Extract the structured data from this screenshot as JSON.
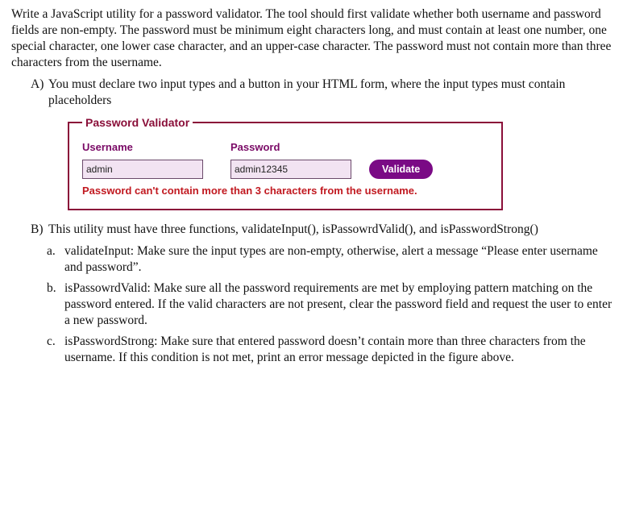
{
  "intro": "Write a JavaScript utility for a password validator. The tool should first validate whether both username and password fields are non-empty. The password must be minimum eight characters long, and must contain at least one number, one special character, one lower case character, and an upper-case character. The password must not contain more than three characters from the username.",
  "itemA": {
    "marker": "A)",
    "text": "You must declare two input types and a button in your HTML form, where the input types must contain placeholders"
  },
  "form": {
    "legend": "Password Validator",
    "username_label": "Username",
    "password_label": "Password",
    "username_value": "admin",
    "password_value": "admin12345",
    "username_placeholder": "",
    "password_placeholder": "",
    "validate_label": "Validate",
    "error_message": "Password can't contain more than 3 characters from the username."
  },
  "itemB": {
    "marker": "B)",
    "text": "This utility must have three functions, validateInput(), isPassowrdValid(), and isPasswordStrong()"
  },
  "sub": {
    "a": {
      "marker": "a.",
      "text": "validateInput: Make sure the input types are non-empty, otherwise, alert a message “Please enter username and password”."
    },
    "b": {
      "marker": "b.",
      "text": "isPassowrdValid: Make sure all the password requirements are met by employing pattern matching on the password entered. If the valid characters are not present, clear the password field and request the user to enter a new password."
    },
    "c": {
      "marker": "c.",
      "text": "isPasswordStrong: Make sure that entered password doesn’t contain more than three characters from the username. If this condition is not met, print an error message depicted in the figure above."
    }
  }
}
